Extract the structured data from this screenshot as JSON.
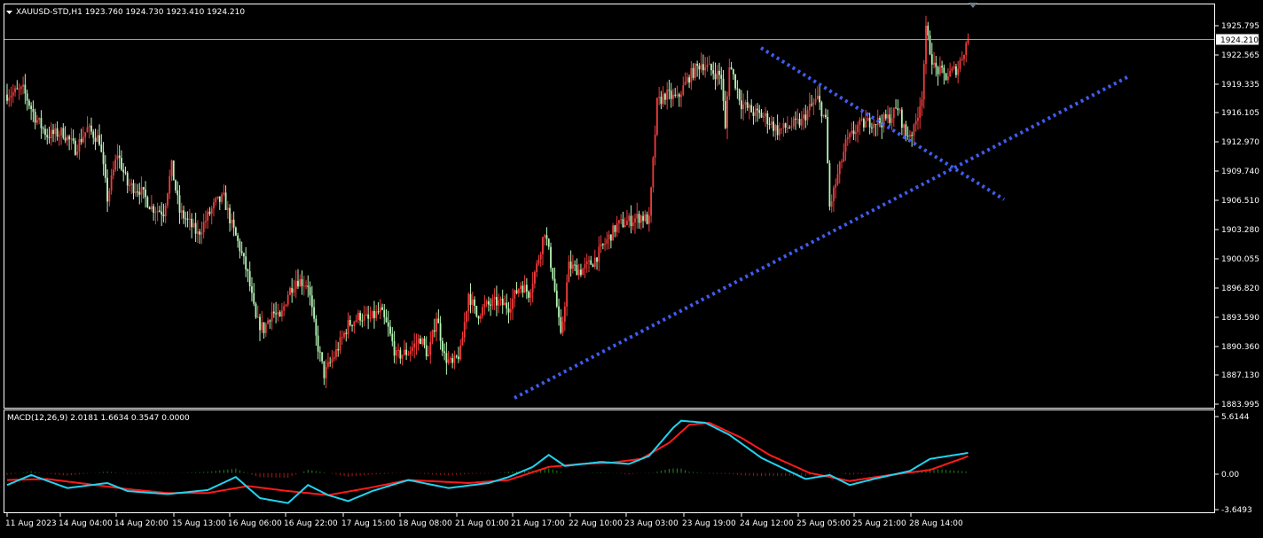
{
  "header": {
    "symbol_line": "XAUUSD-STD,H1  1923.760 1924.730 1923.410 1924.210",
    "macd_line": "MACD(12,26,9) 2.0181 1.6634 0.3547 0.0000"
  },
  "price_marker": "1924.210",
  "colors": {
    "bull": "#f23b3b",
    "bear": "#b6f6b6",
    "grid": "#ffffff",
    "trendline": "#3f5cf0",
    "macd_line": "#22d3f0",
    "signal_line": "#ff1a1a",
    "hist_pos": "#1e8a1e",
    "hist_neg": "#b01414"
  },
  "chart_data": [
    {
      "type": "candlestick",
      "symbol": "XAUUSD-STD",
      "timeframe": "H1",
      "ylim": [
        1883.995,
        1927.0
      ],
      "y_ticks": [
        "1925.795",
        "1922.565",
        "1919.335",
        "1916.105",
        "1912.970",
        "1909.740",
        "1906.510",
        "1903.280",
        "1900.055",
        "1896.820",
        "1893.590",
        "1890.360",
        "1887.130",
        "1883.995"
      ],
      "x_ticks": [
        "11 Aug 2023",
        "14 Aug 04:00",
        "14 Aug 20:00",
        "15 Aug 13:00",
        "16 Aug 06:00",
        "16 Aug 22:00",
        "17 Aug 15:00",
        "18 Aug 08:00",
        "21 Aug 01:00",
        "21 Aug 17:00",
        "22 Aug 10:00",
        "23 Aug 03:00",
        "23 Aug 19:00",
        "24 Aug 12:00",
        "25 Aug 05:00",
        "25 Aug 21:00",
        "28 Aug 14:00"
      ],
      "close_path": [
        [
          0,
          1918.0
        ],
        [
          8,
          1918.5
        ],
        [
          14,
          1915.5
        ],
        [
          20,
          1913.5
        ],
        [
          28,
          1913.8
        ],
        [
          34,
          1912.0
        ],
        [
          40,
          1914.2
        ],
        [
          46,
          1913.0
        ],
        [
          50,
          1906.5
        ],
        [
          55,
          1911.5
        ],
        [
          60,
          1908.0
        ],
        [
          66,
          1907.5
        ],
        [
          72,
          1905.5
        ],
        [
          78,
          1905.0
        ],
        [
          82,
          1910.0
        ],
        [
          86,
          1905.0
        ],
        [
          90,
          1904.0
        ],
        [
          95,
          1902.5
        ],
        [
          100,
          1904.5
        ],
        [
          104,
          1906.0
        ],
        [
          108,
          1906.5
        ],
        [
          112,
          1903.5
        ],
        [
          116,
          1901.0
        ],
        [
          120,
          1898.0
        ],
        [
          124,
          1893.0
        ],
        [
          128,
          1892.0
        ],
        [
          132,
          1894.0
        ],
        [
          136,
          1893.0
        ],
        [
          140,
          1896.0
        ],
        [
          144,
          1897.5
        ],
        [
          150,
          1897.0
        ],
        [
          154,
          1891.0
        ],
        [
          158,
          1887.0
        ],
        [
          164,
          1889.5
        ],
        [
          170,
          1892.5
        ],
        [
          176,
          1893.5
        ],
        [
          180,
          1893.0
        ],
        [
          186,
          1894.0
        ],
        [
          190,
          1892.0
        ],
        [
          194,
          1889.0
        ],
        [
          200,
          1889.5
        ],
        [
          206,
          1891.0
        ],
        [
          210,
          1889.0
        ],
        [
          214,
          1893.5
        ],
        [
          218,
          1889.0
        ],
        [
          222,
          1888.0
        ],
        [
          226,
          1889.5
        ],
        [
          230,
          1896.0
        ],
        [
          234,
          1893.5
        ],
        [
          238,
          1894.5
        ],
        [
          244,
          1895.0
        ],
        [
          250,
          1894.5
        ],
        [
          256,
          1897.0
        ],
        [
          260,
          1896.0
        ],
        [
          264,
          1899.0
        ],
        [
          268,
          1903.0
        ],
        [
          272,
          1898.0
        ],
        [
          276,
          1891.0
        ],
        [
          280,
          1899.0
        ],
        [
          286,
          1898.5
        ],
        [
          292,
          1899.5
        ],
        [
          298,
          1901.5
        ],
        [
          304,
          1903.5
        ],
        [
          310,
          1904.0
        ],
        [
          316,
          1904.5
        ],
        [
          320,
          1904.0
        ],
        [
          324,
          1917.0
        ],
        [
          328,
          1918.0
        ],
        [
          334,
          1917.5
        ],
        [
          340,
          1920.0
        ],
        [
          346,
          1921.5
        ],
        [
          352,
          1920.5
        ],
        [
          356,
          1920.0
        ],
        [
          358,
          1914.0
        ],
        [
          360,
          1921.5
        ],
        [
          366,
          1917.0
        ],
        [
          372,
          1916.0
        ],
        [
          378,
          1915.5
        ],
        [
          384,
          1914.0
        ],
        [
          390,
          1914.5
        ],
        [
          396,
          1915.0
        ],
        [
          400,
          1916.5
        ],
        [
          404,
          1917.5
        ],
        [
          408,
          1915.0
        ],
        [
          410,
          1905.5
        ],
        [
          414,
          1909.0
        ],
        [
          418,
          1912.5
        ],
        [
          424,
          1914.5
        ],
        [
          430,
          1915.0
        ],
        [
          436,
          1915.0
        ],
        [
          440,
          1915.5
        ],
        [
          444,
          1916.5
        ],
        [
          448,
          1913.5
        ],
        [
          452,
          1914.0
        ],
        [
          456,
          1918.0
        ],
        [
          458,
          1925.0
        ],
        [
          462,
          1921.0
        ],
        [
          468,
          1920.0
        ],
        [
          474,
          1921.0
        ],
        [
          479,
          1924.21
        ]
      ]
    },
    {
      "type": "line",
      "name": "MACD(12,26,9)",
      "ylim": [
        -3.6493,
        5.6144
      ],
      "y_ticks": [
        "5.6144",
        "0.00",
        "-3.6493"
      ],
      "macd_path": [
        [
          0,
          -1.2
        ],
        [
          12,
          -0.2
        ],
        [
          30,
          -1.5
        ],
        [
          50,
          -1.0
        ],
        [
          60,
          -1.8
        ],
        [
          80,
          -2.1
        ],
        [
          100,
          -1.7
        ],
        [
          114,
          -0.4
        ],
        [
          126,
          -2.5
        ],
        [
          140,
          -3.0
        ],
        [
          150,
          -1.2
        ],
        [
          160,
          -2.2
        ],
        [
          170,
          -2.8
        ],
        [
          182,
          -1.8
        ],
        [
          200,
          -0.7
        ],
        [
          220,
          -1.5
        ],
        [
          240,
          -1.0
        ],
        [
          250,
          -0.4
        ],
        [
          262,
          0.6
        ],
        [
          270,
          1.8
        ],
        [
          278,
          0.7
        ],
        [
          296,
          1.1
        ],
        [
          310,
          0.9
        ],
        [
          320,
          1.7
        ],
        [
          332,
          4.5
        ],
        [
          336,
          5.2
        ],
        [
          348,
          5.0
        ],
        [
          360,
          3.8
        ],
        [
          376,
          1.5
        ],
        [
          398,
          -0.6
        ],
        [
          410,
          -0.2
        ],
        [
          420,
          -1.2
        ],
        [
          432,
          -0.6
        ],
        [
          450,
          0.2
        ],
        [
          460,
          1.4
        ],
        [
          479,
          2.0
        ]
      ],
      "signal_path": [
        [
          0,
          -0.7
        ],
        [
          20,
          -0.6
        ],
        [
          40,
          -1.1
        ],
        [
          60,
          -1.6
        ],
        [
          80,
          -2.0
        ],
        [
          100,
          -2.0
        ],
        [
          120,
          -1.3
        ],
        [
          140,
          -1.8
        ],
        [
          160,
          -2.2
        ],
        [
          180,
          -1.5
        ],
        [
          200,
          -0.7
        ],
        [
          230,
          -1.0
        ],
        [
          250,
          -0.7
        ],
        [
          270,
          0.6
        ],
        [
          286,
          0.9
        ],
        [
          300,
          1.0
        ],
        [
          316,
          1.4
        ],
        [
          330,
          3.0
        ],
        [
          340,
          4.8
        ],
        [
          350,
          5.0
        ],
        [
          366,
          3.5
        ],
        [
          380,
          1.8
        ],
        [
          400,
          0.0
        ],
        [
          420,
          -0.8
        ],
        [
          440,
          -0.2
        ],
        [
          460,
          0.3
        ],
        [
          479,
          1.66
        ]
      ]
    }
  ]
}
